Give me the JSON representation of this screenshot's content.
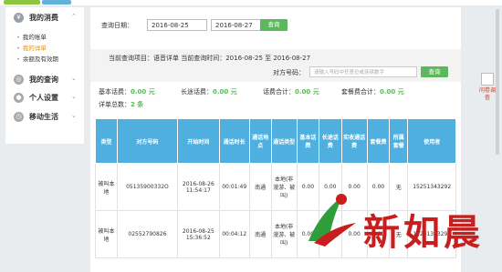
{
  "sidebar": {
    "groups": [
      {
        "label": "我的消费",
        "icon": "yen-icon",
        "arrow": "⌃"
      },
      {
        "label": "我的查询",
        "icon": "search-icon",
        "arrow": "⌄"
      },
      {
        "label": "个人设置",
        "icon": "user-icon",
        "arrow": "⌄"
      },
      {
        "label": "移动生活",
        "icon": "clock-icon",
        "arrow": "⌄"
      }
    ],
    "items": [
      {
        "label": "我的账单",
        "active": false
      },
      {
        "label": "我的详单",
        "active": true
      },
      {
        "label": "余额及有效期",
        "active": false
      }
    ]
  },
  "query": {
    "date_label": "查询日期：",
    "start_date": "2016-08-25",
    "to": "至",
    "end_date": "2016-08-27",
    "button": "查询"
  },
  "info": {
    "line": "当前查询项目：语音详单  当前查询时间：2016-08-25 至 2016-08-27",
    "peer_label": "对方号码：",
    "peer_placeholder": "请输入号码中任意位或连续数字",
    "search_button": "查询"
  },
  "summary": {
    "basic_label": "基本话费：",
    "basic_value": "0.00 元",
    "long_label": "长途话费：",
    "long_value": "0.00 元",
    "total_label": "话费合计：",
    "total_value": "0.00 元",
    "roam_label": "套餐费合计：",
    "roam_value": "0.00 元",
    "count_label": "详单总数：",
    "count_value": "2 条"
  },
  "table": {
    "headers": [
      "类型",
      "对方号码",
      "开始时间",
      "通话时长",
      "通话地点",
      "通话类型",
      "基本话费",
      "长途话费",
      "实收通话费",
      "套餐费",
      "所属套餐",
      "使用者"
    ],
    "rows": [
      [
        "被叫本地",
        "05135900332O",
        "2016-08-26 11:54:17",
        "00:01:49",
        "南通",
        "本地(非漫游、被叫)",
        "0.00",
        "0.00",
        "0.00",
        "0.00",
        "无",
        "15251343292"
      ],
      [
        "被叫本地",
        "02552790826",
        "2016-08-25 15:36:52",
        "00:04:12",
        "南通",
        "本地(非漫游、被叫)",
        "0.00",
        "0.00",
        "0.00",
        "0.00",
        "无",
        "15251343292"
      ]
    ]
  },
  "right_panel": {
    "label": "问卷调查"
  },
  "watermark": {
    "text": "新如晨"
  },
  "colors": {
    "accent_green": "#5cb85c",
    "table_header": "#4fb0e0",
    "active_orange": "#f08a00",
    "watermark_red": "#c81e1e"
  }
}
